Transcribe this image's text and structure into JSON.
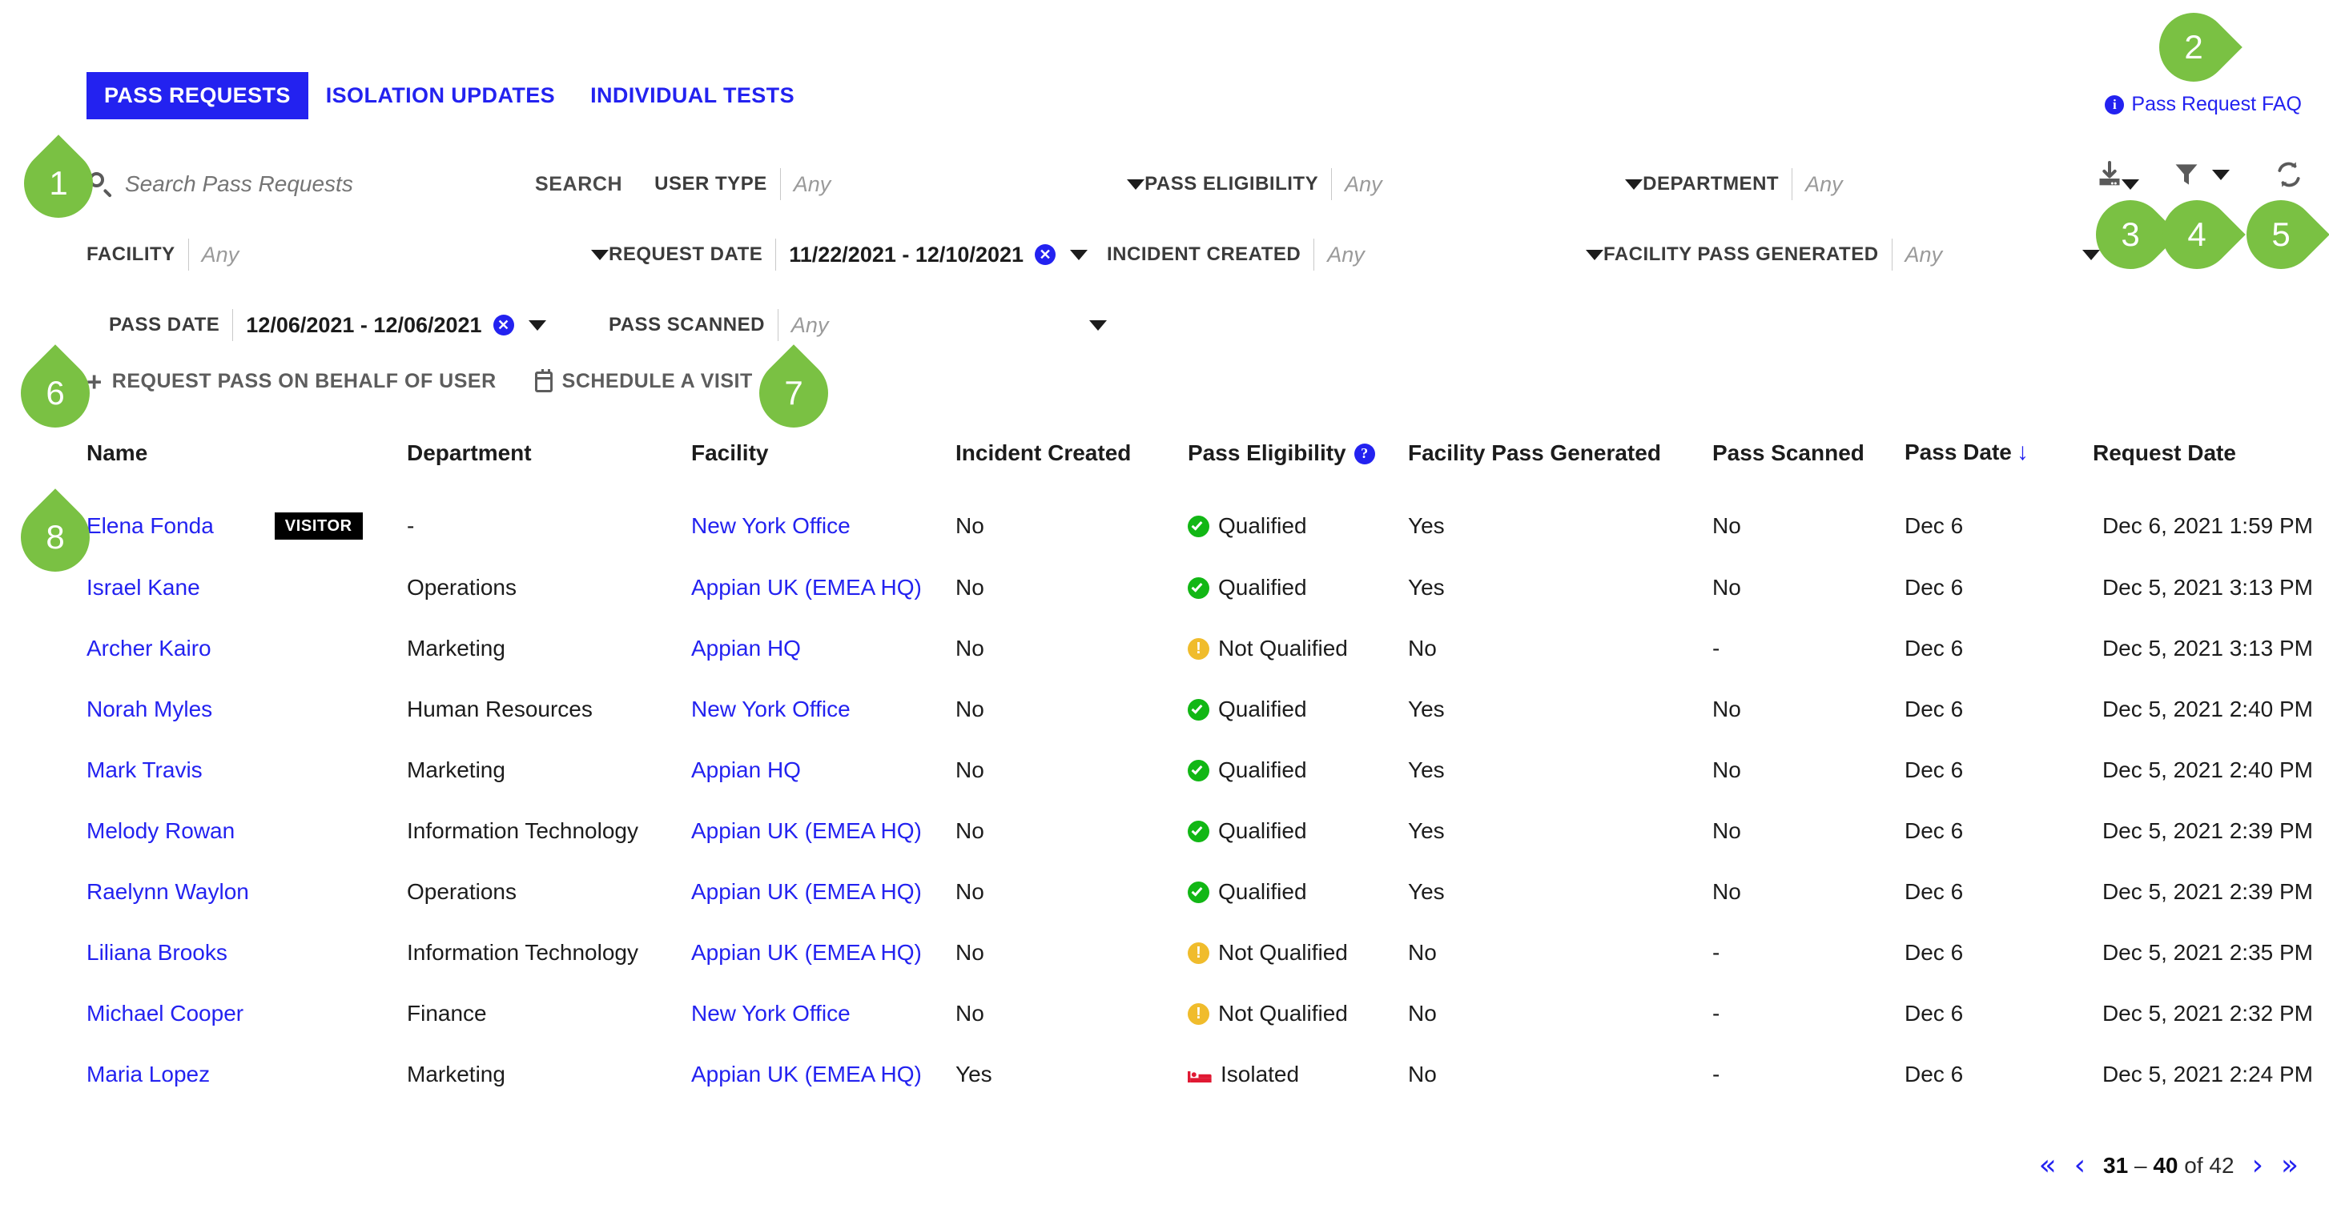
{
  "tabs": [
    {
      "label": "PASS REQUESTS",
      "active": true
    },
    {
      "label": "ISOLATION UPDATES",
      "active": false
    },
    {
      "label": "INDIVIDUAL TESTS",
      "active": false
    }
  ],
  "faq": {
    "label": "Pass Request FAQ",
    "icon": "info-icon"
  },
  "search": {
    "placeholder": "Search Pass Requests",
    "value": "",
    "button_label": "SEARCH",
    "icon": "search-icon"
  },
  "filters": [
    {
      "label": "USER TYPE",
      "value": "Any",
      "is_set": false,
      "clearable": false
    },
    {
      "label": "PASS ELIGIBILITY",
      "value": "Any",
      "is_set": false,
      "clearable": false
    },
    {
      "label": "DEPARTMENT",
      "value": "Any",
      "is_set": false,
      "clearable": false
    },
    {
      "label": "FACILITY",
      "value": "Any",
      "is_set": false,
      "clearable": false
    },
    {
      "label": "REQUEST DATE",
      "value": "11/22/2021 - 12/10/2021",
      "is_set": true,
      "clearable": true
    },
    {
      "label": "INCIDENT CREATED",
      "value": "Any",
      "is_set": false,
      "clearable": false
    },
    {
      "label": "FACILITY PASS GENERATED",
      "value": "Any",
      "is_set": false,
      "clearable": false
    },
    {
      "label": "PASS DATE",
      "value": "12/06/2021 - 12/06/2021",
      "is_set": true,
      "clearable": true
    },
    {
      "label": "PASS SCANNED",
      "value": "Any",
      "is_set": false,
      "clearable": false
    }
  ],
  "toolbar_icons": [
    {
      "name": "download-icon"
    },
    {
      "name": "filter-icon"
    },
    {
      "name": "refresh-icon"
    }
  ],
  "actions": [
    {
      "label": "REQUEST PASS ON BEHALF OF USER",
      "icon": "plus-icon"
    },
    {
      "label": "SCHEDULE A VISIT",
      "icon": "calendar-icon"
    }
  ],
  "table": {
    "columns": [
      "Name",
      "Department",
      "Facility",
      "Incident Created",
      "Pass Eligibility",
      "Facility Pass Generated",
      "Pass Scanned",
      "Pass Date",
      "Request Date"
    ],
    "sort_column": "Pass Date",
    "sort_direction": "descending",
    "rows": [
      {
        "name": "Elena Fonda",
        "badge": "VISITOR",
        "department": "-",
        "facility": "New York Office",
        "incident_created": "No",
        "pass_eligibility": "Qualified",
        "eligibility_icon": "check-circle-icon",
        "facility_pass_generated": "Yes",
        "pass_scanned": "No",
        "pass_date": "Dec 6",
        "request_date": "Dec 6, 2021 1:59 PM"
      },
      {
        "name": "Israel Kane",
        "badge": "",
        "department": "Operations",
        "facility": "Appian UK (EMEA HQ)",
        "incident_created": "No",
        "pass_eligibility": "Qualified",
        "eligibility_icon": "check-circle-icon",
        "facility_pass_generated": "Yes",
        "pass_scanned": "No",
        "pass_date": "Dec 6",
        "request_date": "Dec 5, 2021 3:13 PM"
      },
      {
        "name": "Archer Kairo",
        "badge": "",
        "department": "Marketing",
        "facility": "Appian HQ",
        "incident_created": "No",
        "pass_eligibility": "Not Qualified",
        "eligibility_icon": "warning-circle-icon",
        "facility_pass_generated": "No",
        "pass_scanned": "-",
        "pass_date": "Dec 6",
        "request_date": "Dec 5, 2021 3:13 PM"
      },
      {
        "name": "Norah Myles",
        "badge": "",
        "department": "Human Resources",
        "facility": "New York Office",
        "incident_created": "No",
        "pass_eligibility": "Qualified",
        "eligibility_icon": "check-circle-icon",
        "facility_pass_generated": "Yes",
        "pass_scanned": "No",
        "pass_date": "Dec 6",
        "request_date": "Dec 5, 2021 2:40 PM"
      },
      {
        "name": "Mark Travis",
        "badge": "",
        "department": "Marketing",
        "facility": "Appian HQ",
        "incident_created": "No",
        "pass_eligibility": "Qualified",
        "eligibility_icon": "check-circle-icon",
        "facility_pass_generated": "Yes",
        "pass_scanned": "No",
        "pass_date": "Dec 6",
        "request_date": "Dec 5, 2021 2:40 PM"
      },
      {
        "name": "Melody Rowan",
        "badge": "",
        "department": "Information Technology",
        "facility": "Appian UK (EMEA HQ)",
        "incident_created": "No",
        "pass_eligibility": "Qualified",
        "eligibility_icon": "check-circle-icon",
        "facility_pass_generated": "Yes",
        "pass_scanned": "No",
        "pass_date": "Dec 6",
        "request_date": "Dec 5, 2021 2:39 PM"
      },
      {
        "name": "Raelynn Waylon",
        "badge": "",
        "department": "Operations",
        "facility": "Appian UK (EMEA HQ)",
        "incident_created": "No",
        "pass_eligibility": "Qualified",
        "eligibility_icon": "check-circle-icon",
        "facility_pass_generated": "Yes",
        "pass_scanned": "No",
        "pass_date": "Dec 6",
        "request_date": "Dec 5, 2021 2:39 PM"
      },
      {
        "name": "Liliana Brooks",
        "badge": "",
        "department": "Information Technology",
        "facility": "Appian UK (EMEA HQ)",
        "incident_created": "No",
        "pass_eligibility": "Not Qualified",
        "eligibility_icon": "warning-circle-icon",
        "facility_pass_generated": "No",
        "pass_scanned": "-",
        "pass_date": "Dec 6",
        "request_date": "Dec 5, 2021 2:35 PM"
      },
      {
        "name": "Michael Cooper",
        "badge": "",
        "department": "Finance",
        "facility": "New York Office",
        "incident_created": "No",
        "pass_eligibility": "Not Qualified",
        "eligibility_icon": "warning-circle-icon",
        "facility_pass_generated": "No",
        "pass_scanned": "-",
        "pass_date": "Dec 6",
        "request_date": "Dec 5, 2021 2:32 PM"
      },
      {
        "name": "Maria Lopez",
        "badge": "",
        "department": "Marketing",
        "facility": "Appian UK (EMEA HQ)",
        "incident_created": "Yes",
        "pass_eligibility": "Isolated",
        "eligibility_icon": "bed-icon",
        "facility_pass_generated": "No",
        "pass_scanned": "-",
        "pass_date": "Dec 6",
        "request_date": "Dec 5, 2021 2:24 PM"
      }
    ]
  },
  "pagination": {
    "range_start": "31",
    "range_end": "40",
    "of_label": "of",
    "total": "42",
    "first_icon": "«",
    "prev_icon": "‹",
    "next_icon": "›",
    "last_icon": "»"
  },
  "callouts": [
    {
      "num": "1"
    },
    {
      "num": "2"
    },
    {
      "num": "3"
    },
    {
      "num": "4"
    },
    {
      "num": "5"
    },
    {
      "num": "6"
    },
    {
      "num": "7"
    },
    {
      "num": "8"
    }
  ],
  "colors": {
    "accent_blue": "#2322f0",
    "callout_green": "#7ac143",
    "status_green": "#4f9b38",
    "status_red": "#ed2939",
    "qualified_green": "#12b715",
    "warn_yellow": "#f0bc2c",
    "isolated_red": "#e01933"
  }
}
